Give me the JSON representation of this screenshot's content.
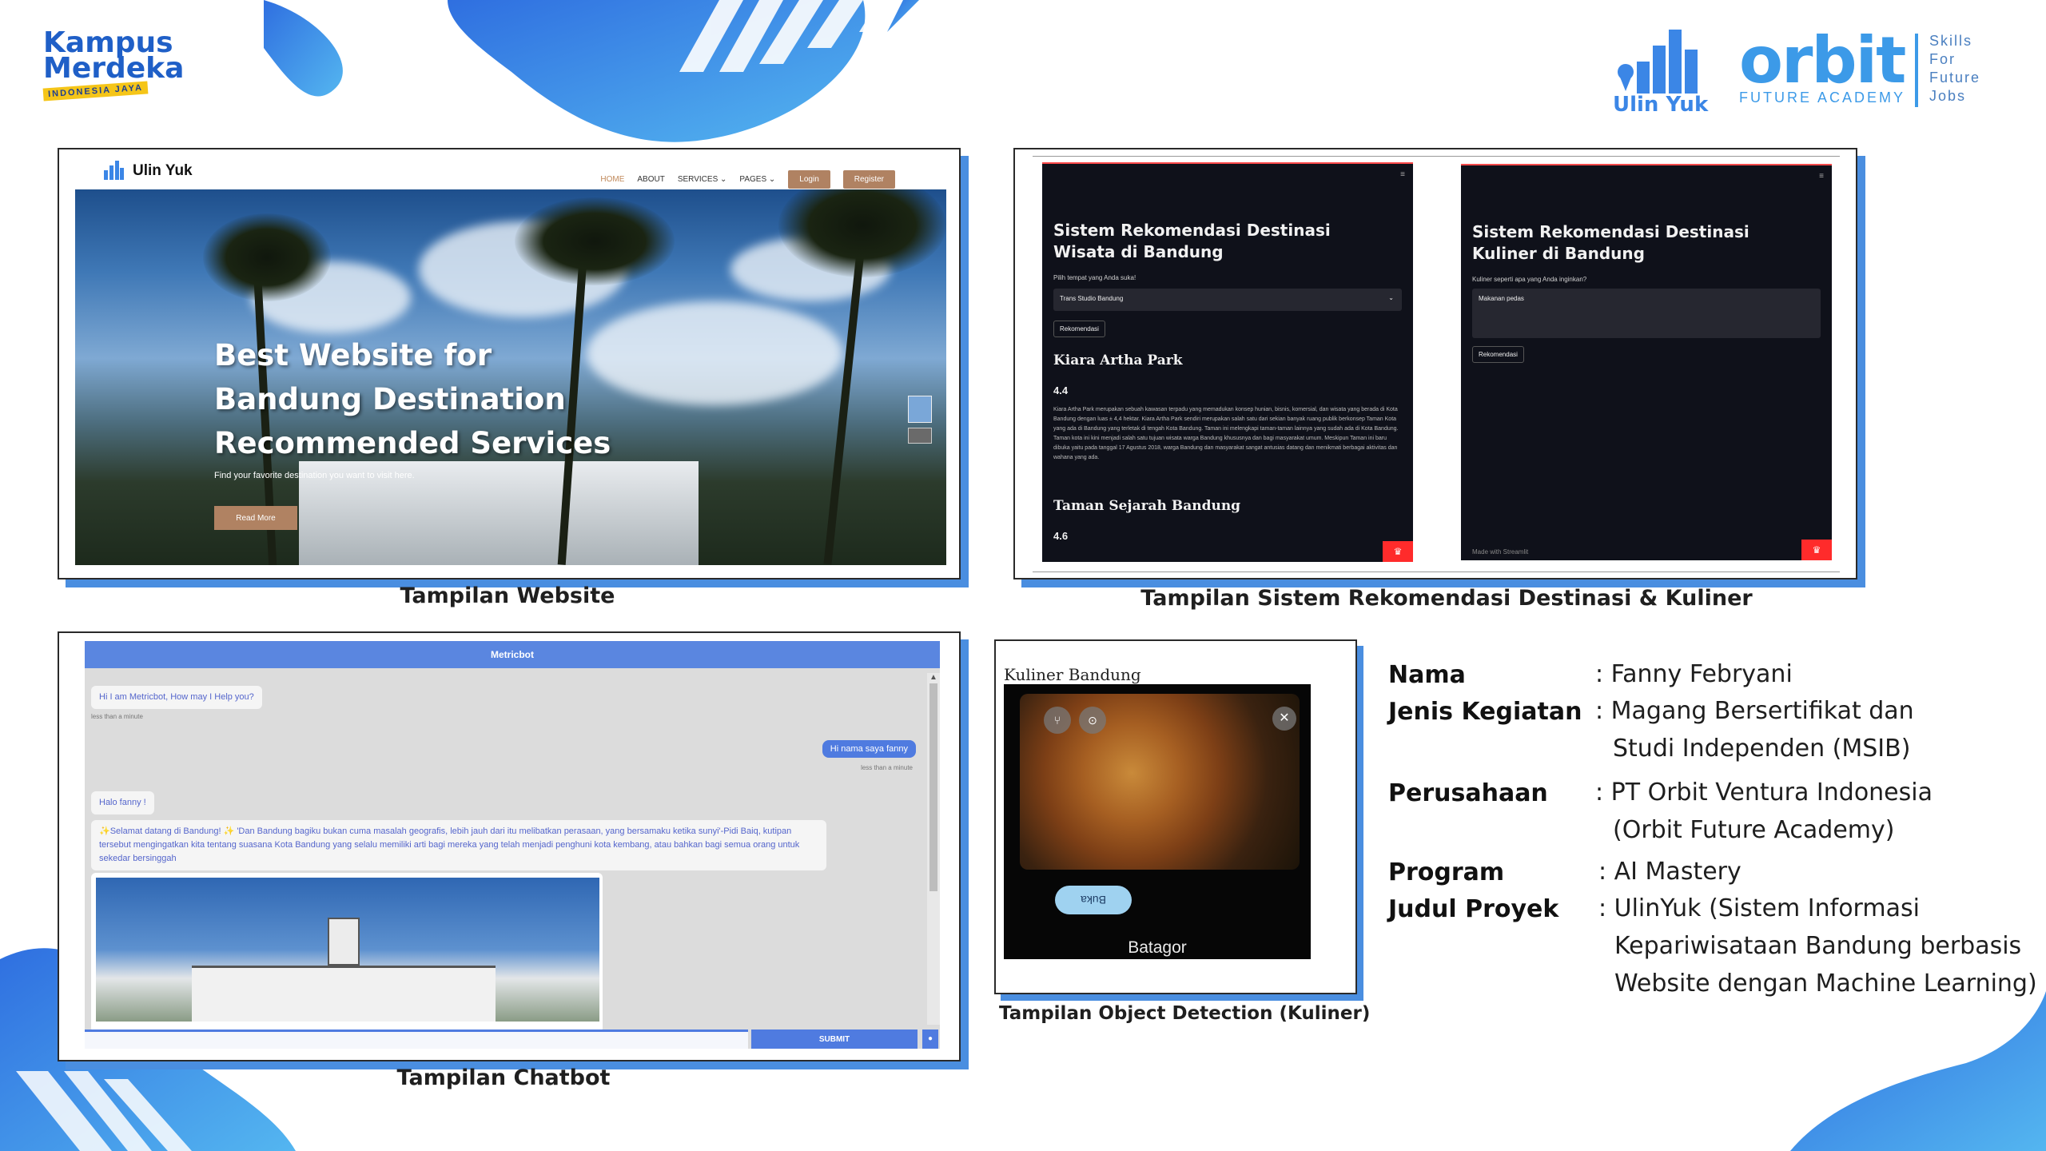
{
  "logos": {
    "kampus_line1": "Kampus",
    "kampus_line2": "Merdeka",
    "kampus_tag": "INDONESIA JAYA",
    "ulinyuk": "Ulin Yuk",
    "orbit": "orbit",
    "orbit_sub": "FUTURE ACADEMY",
    "orbit_tagline": [
      "Skills",
      "For",
      "Future",
      "Jobs"
    ]
  },
  "website": {
    "brand": "Ulin Yuk",
    "menu": [
      "HOME",
      "ABOUT",
      "SERVICES ⌄",
      "PAGES ⌄"
    ],
    "login": "Login",
    "register": "Register",
    "hero_title": "Best Website for Bandung Destination Recommended Services",
    "hero_sub": "Find your favorite destination you want to visit here.",
    "hero_button": "Read More",
    "caption": "Tampilan Website"
  },
  "reco_wisata": {
    "title": "Sistem Rekomendasi Destinasi Wisata di Bandung",
    "prompt": "Pilih tempat yang Anda suka!",
    "select_value": "Trans Studio Bandung",
    "button": "Rekomendasi",
    "place1": "Kiara Artha Park",
    "rating1": "4.4",
    "desc1": "Kiara Artha Park merupakan sebuah kawasan terpadu yang memadukan konsep hunian, bisnis, komersial, dan wisata yang berada di Kota Bandung dengan luas ± 4,4 hektar. Kiara Artha Park sendiri merupakan salah satu dari sekian banyak ruang publik berkonsep Taman Kota yang ada di Bandung yang terletak di tengah Kota Bandung. Taman ini melengkapi taman-taman lainnya yang sudah ada di Kota Bandung. Taman kota ini kini menjadi salah satu tujuan wisata warga Bandung khususnya dan bagi masyarakat umum. Meskipun Taman ini baru dibuka yaitu pada tanggal 17 Agustus 2018, warga Bandung dan masyarakat sangat antusias datang dan menikmati berbagai aktivitas dan wahana yang ada.",
    "place2": "Taman Sejarah Bandung",
    "rating2": "4.6"
  },
  "reco_kuliner": {
    "title": "Sistem Rekomendasi Destinasi Kuliner di Bandung",
    "prompt": "Kuliner seperti apa yang Anda inginkan?",
    "input_value": "Makanan pedas",
    "button": "Rekomendasi",
    "footer": "Made with Streamlit"
  },
  "reco_caption": "Tampilan Sistem Rekomendasi Destinasi & Kuliner",
  "chatbot": {
    "header": "Metricbot",
    "msg1": "Hi I am Metricbot, How may I Help you?",
    "ts1": "less than a minute",
    "user1": "Hi nama saya fanny",
    "ts2": "less than a minute",
    "msg2": "Halo fanny !",
    "msg3": "✨Selamat datang di Bandung! ✨ 'Dan Bandung bagiku bukan cuma masalah geografis, lebih jauh dari itu melibatkan perasaan, yang bersamaku ketika sunyi'-Pidi Baiq, kutipan tersebut mengingatkan kita tentang suasana Kota Bandung yang selalu memiliki arti bagi mereka yang telah menjadi penghuni kota kembang, atau bahkan bagi semua orang untuk sekedar bersinggah",
    "submit": "SUBMIT",
    "caption": "Tampilan Chatbot"
  },
  "object_detection": {
    "title": "Kuliner Bandung",
    "label": "Batagor",
    "buka": "Buka",
    "caption": "Tampilan Object Detection (Kuliner)"
  },
  "info": {
    "labels": [
      "Nama",
      "Jenis Kegiatan",
      "Perusahaan",
      "Program",
      "Judul Proyek"
    ],
    "nama": ": Fanny Febryani",
    "jenis_1": ": Magang Bersertifikat dan",
    "jenis_2": "Studi Independen (MSIB)",
    "perusahaan_1": ": PT Orbit Ventura Indonesia",
    "perusahaan_2": "(Orbit Future Academy)",
    "program": ": AI Mastery",
    "judul_1": ": UlinYuk (Sistem Informasi",
    "judul_2": "Kepariwisataan Bandung berbasis",
    "judul_3": "Website dengan Machine Learning)"
  },
  "colors": {
    "accent": "#4a8ee0",
    "brand_blue": "#2f7fe0",
    "tan": "#b08262"
  }
}
